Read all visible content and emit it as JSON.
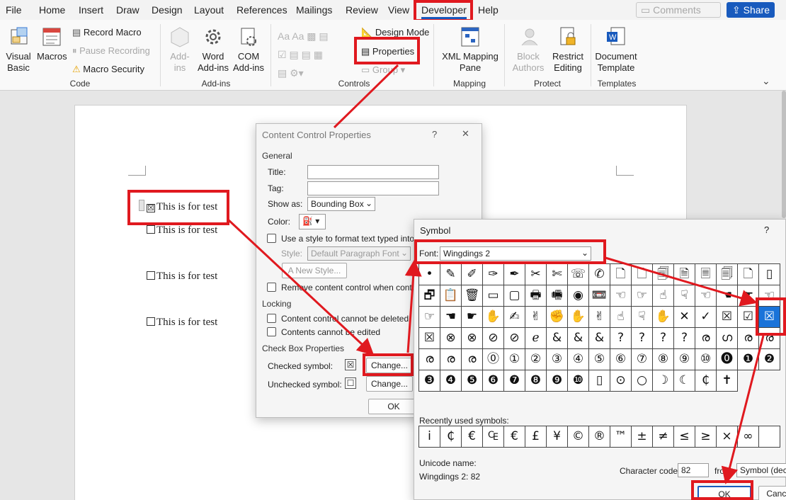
{
  "tabs": [
    "File",
    "Home",
    "Insert",
    "Draw",
    "Design",
    "Layout",
    "References",
    "Mailings",
    "Review",
    "View",
    "Developer",
    "Help"
  ],
  "active_tab": "Developer",
  "header_right": {
    "comments": "Comments",
    "share": "Share"
  },
  "ribbon": {
    "code": {
      "visual_basic": "Visual Basic",
      "macros": "Macros",
      "record_macro": "Record Macro",
      "pause_recording": "Pause Recording",
      "macro_security": "Macro Security",
      "label": "Code"
    },
    "addins": {
      "add_ins": "Add-ins",
      "word_addins": "Word Add-ins",
      "com_addins": "COM Add-ins",
      "label": "Add-ins"
    },
    "controls": {
      "design_mode": "Design Mode",
      "properties": "Properties",
      "group": "Group",
      "label": "Controls"
    },
    "mapping": {
      "xml_mapping_pane": "XML Mapping Pane",
      "label": "Mapping"
    },
    "protect": {
      "block_authors": "Block Authors",
      "restrict_editing": "Restrict Editing",
      "label": "Protect"
    },
    "templates": {
      "document_template": "Document Template",
      "label": "Templates"
    }
  },
  "document": {
    "lines": [
      "This is for test",
      "This is for test",
      "This is for test",
      "This is for test"
    ],
    "checked_symbol": "☒",
    "unchecked_symbol": "☐"
  },
  "ccp_dialog": {
    "title": "Content Control Properties",
    "help": "?",
    "close": "✕",
    "general": "General",
    "title_label": "Title:",
    "title_value": "",
    "tag_label": "Tag:",
    "tag_value": "",
    "show_as_label": "Show as:",
    "show_as_value": "Bounding Box",
    "color_label": "Color:",
    "use_style": "Use a style to format text typed into t",
    "style_label": "Style:",
    "style_value": "Default Paragraph Font",
    "new_style": "New Style...",
    "remove_cc": "Remove content control when conte",
    "locking": "Locking",
    "lock_delete": "Content control cannot be deleted",
    "lock_edit": "Contents cannot be edited",
    "checkbox_props": "Check Box Properties",
    "checked_label": "Checked symbol:",
    "checked_symbol": "☒",
    "unchecked_label": "Unchecked symbol:",
    "unchecked_symbol": "☐",
    "change": "Change...",
    "ok": "OK"
  },
  "symbol_dialog": {
    "title": "Symbol",
    "help": "?",
    "font_label": "Font:",
    "font_value": "Wingdings 2",
    "symbols": [
      "•",
      "✎",
      "✐",
      "✑",
      "✒",
      "✂",
      "✄",
      "☏",
      "✆",
      "🗋",
      "🗋",
      "🗐",
      "🗎",
      "🗏",
      "🗐",
      "🗋",
      "▯",
      "🗗",
      "📋",
      "🗑",
      "▭",
      "▢",
      "🖶",
      "🖷",
      "◉",
      "📼",
      "☜",
      "☞",
      "☝",
      "☟",
      "☜",
      "☚",
      "☛",
      "☜",
      "☞",
      "☚",
      "☛",
      "✋",
      "✍",
      "✌",
      "✊",
      "✋",
      "✌",
      "☝",
      "☟",
      "✋",
      "✕",
      "✓",
      "☒",
      "☑",
      "☒",
      "☒",
      "⊗",
      "⊗",
      "⊘",
      "⊘",
      "ℯ",
      "&",
      "&",
      "&",
      "?",
      "?",
      "?",
      "?",
      "ര",
      "ഗ",
      "ര",
      "ര",
      "ര",
      "ര",
      "ര",
      "⓪",
      "①",
      "②",
      "③",
      "④",
      "⑤",
      "⑥",
      "⑦",
      "⑧",
      "⑨",
      "⑩",
      "⓿",
      "❶",
      "❷",
      "❸",
      "❹",
      "❺",
      "❻",
      "❼",
      "❽",
      "❾",
      "❿",
      "▯",
      "⊙",
      "○",
      "☽",
      "☾",
      "₵",
      "✝"
    ],
    "selected_index": 50,
    "recently_used_label": "Recently used symbols:",
    "recent": [
      "i",
      "₵",
      "€",
      "₠",
      "€",
      "£",
      "¥",
      "©",
      "®",
      "™",
      "±",
      "≠",
      "≤",
      "≥",
      "×",
      "∞",
      ""
    ],
    "unicode_name_label": "Unicode name:",
    "unicode_name_value": "Wingdings 2: 82",
    "char_code_label": "Character code:",
    "char_code_value": "82",
    "from_label": "from:",
    "from_value": "Symbol (decimal)",
    "ok": "OK",
    "cancel": "Cancel"
  },
  "annotation_color": "#e0191f"
}
